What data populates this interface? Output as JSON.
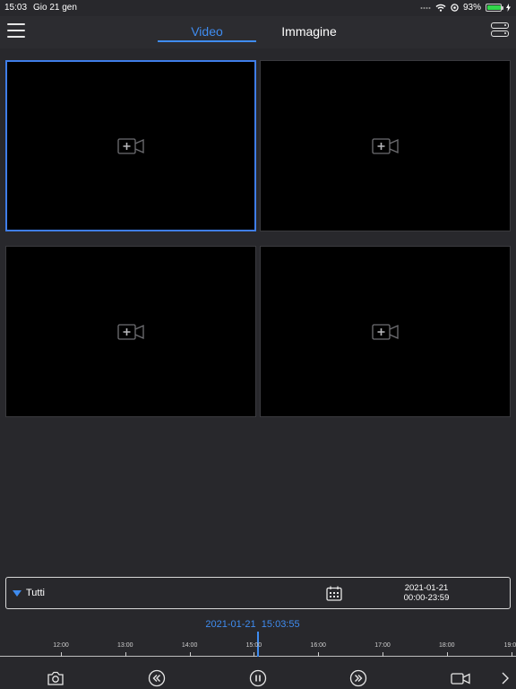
{
  "status_bar": {
    "time": "15:03",
    "date": "Gio 21 gen",
    "battery": "93%",
    "battery_level": 0.93
  },
  "nav": {
    "tabs": [
      {
        "label": "Video",
        "active": true
      },
      {
        "label": "Immagine",
        "active": false
      }
    ]
  },
  "grid": {
    "cells": [
      {
        "selected": true,
        "icon": "add-camera-icon"
      },
      {
        "selected": false,
        "icon": "add-camera-icon"
      },
      {
        "selected": false,
        "icon": "add-camera-icon"
      },
      {
        "selected": false,
        "icon": "add-camera-icon"
      }
    ]
  },
  "filter": {
    "label": "Tutti",
    "date": "2021-01-21",
    "time_range": "00:00-23:59"
  },
  "timeline": {
    "current_date": "2021-01-21",
    "current_time": "15:03:55",
    "ticks": [
      "12:00",
      "13:00",
      "14:00",
      "15:00",
      "16:00",
      "17:00",
      "18:00",
      "19:00"
    ]
  },
  "colors": {
    "accent": "#3f8cf0",
    "background": "#28282c",
    "cell": "#000000"
  }
}
